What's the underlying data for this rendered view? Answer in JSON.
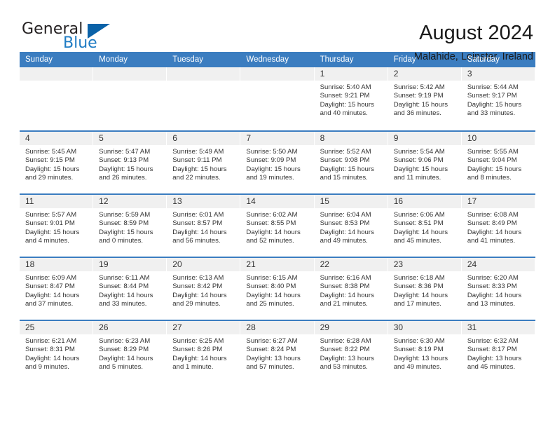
{
  "logo": {
    "text_primary": "General",
    "text_secondary": "Blue",
    "icon": "triangle-icon",
    "color_primary": "#231f20",
    "color_secondary": "#1f7cc4",
    "color_triangle": "#0a62a8"
  },
  "header": {
    "title": "August 2024",
    "subtitle": "Malahide, Leinster, Ireland"
  },
  "theme": {
    "header_row_bg": "#3b7dc0",
    "row_divider": "#3b7dc0",
    "day_band_bg": "#f0f0f0",
    "text": "#333333"
  },
  "weekdays": [
    "Sunday",
    "Monday",
    "Tuesday",
    "Wednesday",
    "Thursday",
    "Friday",
    "Saturday"
  ],
  "weeks": [
    [
      {
        "day": "",
        "empty": true,
        "sunrise": "",
        "sunset": "",
        "daylight1": "",
        "daylight2": ""
      },
      {
        "day": "",
        "empty": true,
        "sunrise": "",
        "sunset": "",
        "daylight1": "",
        "daylight2": ""
      },
      {
        "day": "",
        "empty": true,
        "sunrise": "",
        "sunset": "",
        "daylight1": "",
        "daylight2": ""
      },
      {
        "day": "",
        "empty": true,
        "sunrise": "",
        "sunset": "",
        "daylight1": "",
        "daylight2": ""
      },
      {
        "day": "1",
        "empty": false,
        "sunrise": "Sunrise: 5:40 AM",
        "sunset": "Sunset: 9:21 PM",
        "daylight1": "Daylight: 15 hours",
        "daylight2": "and 40 minutes."
      },
      {
        "day": "2",
        "empty": false,
        "sunrise": "Sunrise: 5:42 AM",
        "sunset": "Sunset: 9:19 PM",
        "daylight1": "Daylight: 15 hours",
        "daylight2": "and 36 minutes."
      },
      {
        "day": "3",
        "empty": false,
        "sunrise": "Sunrise: 5:44 AM",
        "sunset": "Sunset: 9:17 PM",
        "daylight1": "Daylight: 15 hours",
        "daylight2": "and 33 minutes."
      }
    ],
    [
      {
        "day": "4",
        "empty": false,
        "sunrise": "Sunrise: 5:45 AM",
        "sunset": "Sunset: 9:15 PM",
        "daylight1": "Daylight: 15 hours",
        "daylight2": "and 29 minutes."
      },
      {
        "day": "5",
        "empty": false,
        "sunrise": "Sunrise: 5:47 AM",
        "sunset": "Sunset: 9:13 PM",
        "daylight1": "Daylight: 15 hours",
        "daylight2": "and 26 minutes."
      },
      {
        "day": "6",
        "empty": false,
        "sunrise": "Sunrise: 5:49 AM",
        "sunset": "Sunset: 9:11 PM",
        "daylight1": "Daylight: 15 hours",
        "daylight2": "and 22 minutes."
      },
      {
        "day": "7",
        "empty": false,
        "sunrise": "Sunrise: 5:50 AM",
        "sunset": "Sunset: 9:09 PM",
        "daylight1": "Daylight: 15 hours",
        "daylight2": "and 19 minutes."
      },
      {
        "day": "8",
        "empty": false,
        "sunrise": "Sunrise: 5:52 AM",
        "sunset": "Sunset: 9:08 PM",
        "daylight1": "Daylight: 15 hours",
        "daylight2": "and 15 minutes."
      },
      {
        "day": "9",
        "empty": false,
        "sunrise": "Sunrise: 5:54 AM",
        "sunset": "Sunset: 9:06 PM",
        "daylight1": "Daylight: 15 hours",
        "daylight2": "and 11 minutes."
      },
      {
        "day": "10",
        "empty": false,
        "sunrise": "Sunrise: 5:55 AM",
        "sunset": "Sunset: 9:04 PM",
        "daylight1": "Daylight: 15 hours",
        "daylight2": "and 8 minutes."
      }
    ],
    [
      {
        "day": "11",
        "empty": false,
        "sunrise": "Sunrise: 5:57 AM",
        "sunset": "Sunset: 9:01 PM",
        "daylight1": "Daylight: 15 hours",
        "daylight2": "and 4 minutes."
      },
      {
        "day": "12",
        "empty": false,
        "sunrise": "Sunrise: 5:59 AM",
        "sunset": "Sunset: 8:59 PM",
        "daylight1": "Daylight: 15 hours",
        "daylight2": "and 0 minutes."
      },
      {
        "day": "13",
        "empty": false,
        "sunrise": "Sunrise: 6:01 AM",
        "sunset": "Sunset: 8:57 PM",
        "daylight1": "Daylight: 14 hours",
        "daylight2": "and 56 minutes."
      },
      {
        "day": "14",
        "empty": false,
        "sunrise": "Sunrise: 6:02 AM",
        "sunset": "Sunset: 8:55 PM",
        "daylight1": "Daylight: 14 hours",
        "daylight2": "and 52 minutes."
      },
      {
        "day": "15",
        "empty": false,
        "sunrise": "Sunrise: 6:04 AM",
        "sunset": "Sunset: 8:53 PM",
        "daylight1": "Daylight: 14 hours",
        "daylight2": "and 49 minutes."
      },
      {
        "day": "16",
        "empty": false,
        "sunrise": "Sunrise: 6:06 AM",
        "sunset": "Sunset: 8:51 PM",
        "daylight1": "Daylight: 14 hours",
        "daylight2": "and 45 minutes."
      },
      {
        "day": "17",
        "empty": false,
        "sunrise": "Sunrise: 6:08 AM",
        "sunset": "Sunset: 8:49 PM",
        "daylight1": "Daylight: 14 hours",
        "daylight2": "and 41 minutes."
      }
    ],
    [
      {
        "day": "18",
        "empty": false,
        "sunrise": "Sunrise: 6:09 AM",
        "sunset": "Sunset: 8:47 PM",
        "daylight1": "Daylight: 14 hours",
        "daylight2": "and 37 minutes."
      },
      {
        "day": "19",
        "empty": false,
        "sunrise": "Sunrise: 6:11 AM",
        "sunset": "Sunset: 8:44 PM",
        "daylight1": "Daylight: 14 hours",
        "daylight2": "and 33 minutes."
      },
      {
        "day": "20",
        "empty": false,
        "sunrise": "Sunrise: 6:13 AM",
        "sunset": "Sunset: 8:42 PM",
        "daylight1": "Daylight: 14 hours",
        "daylight2": "and 29 minutes."
      },
      {
        "day": "21",
        "empty": false,
        "sunrise": "Sunrise: 6:15 AM",
        "sunset": "Sunset: 8:40 PM",
        "daylight1": "Daylight: 14 hours",
        "daylight2": "and 25 minutes."
      },
      {
        "day": "22",
        "empty": false,
        "sunrise": "Sunrise: 6:16 AM",
        "sunset": "Sunset: 8:38 PM",
        "daylight1": "Daylight: 14 hours",
        "daylight2": "and 21 minutes."
      },
      {
        "day": "23",
        "empty": false,
        "sunrise": "Sunrise: 6:18 AM",
        "sunset": "Sunset: 8:36 PM",
        "daylight1": "Daylight: 14 hours",
        "daylight2": "and 17 minutes."
      },
      {
        "day": "24",
        "empty": false,
        "sunrise": "Sunrise: 6:20 AM",
        "sunset": "Sunset: 8:33 PM",
        "daylight1": "Daylight: 14 hours",
        "daylight2": "and 13 minutes."
      }
    ],
    [
      {
        "day": "25",
        "empty": false,
        "sunrise": "Sunrise: 6:21 AM",
        "sunset": "Sunset: 8:31 PM",
        "daylight1": "Daylight: 14 hours",
        "daylight2": "and 9 minutes."
      },
      {
        "day": "26",
        "empty": false,
        "sunrise": "Sunrise: 6:23 AM",
        "sunset": "Sunset: 8:29 PM",
        "daylight1": "Daylight: 14 hours",
        "daylight2": "and 5 minutes."
      },
      {
        "day": "27",
        "empty": false,
        "sunrise": "Sunrise: 6:25 AM",
        "sunset": "Sunset: 8:26 PM",
        "daylight1": "Daylight: 14 hours",
        "daylight2": "and 1 minute."
      },
      {
        "day": "28",
        "empty": false,
        "sunrise": "Sunrise: 6:27 AM",
        "sunset": "Sunset: 8:24 PM",
        "daylight1": "Daylight: 13 hours",
        "daylight2": "and 57 minutes."
      },
      {
        "day": "29",
        "empty": false,
        "sunrise": "Sunrise: 6:28 AM",
        "sunset": "Sunset: 8:22 PM",
        "daylight1": "Daylight: 13 hours",
        "daylight2": "and 53 minutes."
      },
      {
        "day": "30",
        "empty": false,
        "sunrise": "Sunrise: 6:30 AM",
        "sunset": "Sunset: 8:19 PM",
        "daylight1": "Daylight: 13 hours",
        "daylight2": "and 49 minutes."
      },
      {
        "day": "31",
        "empty": false,
        "sunrise": "Sunrise: 6:32 AM",
        "sunset": "Sunset: 8:17 PM",
        "daylight1": "Daylight: 13 hours",
        "daylight2": "and 45 minutes."
      }
    ]
  ]
}
